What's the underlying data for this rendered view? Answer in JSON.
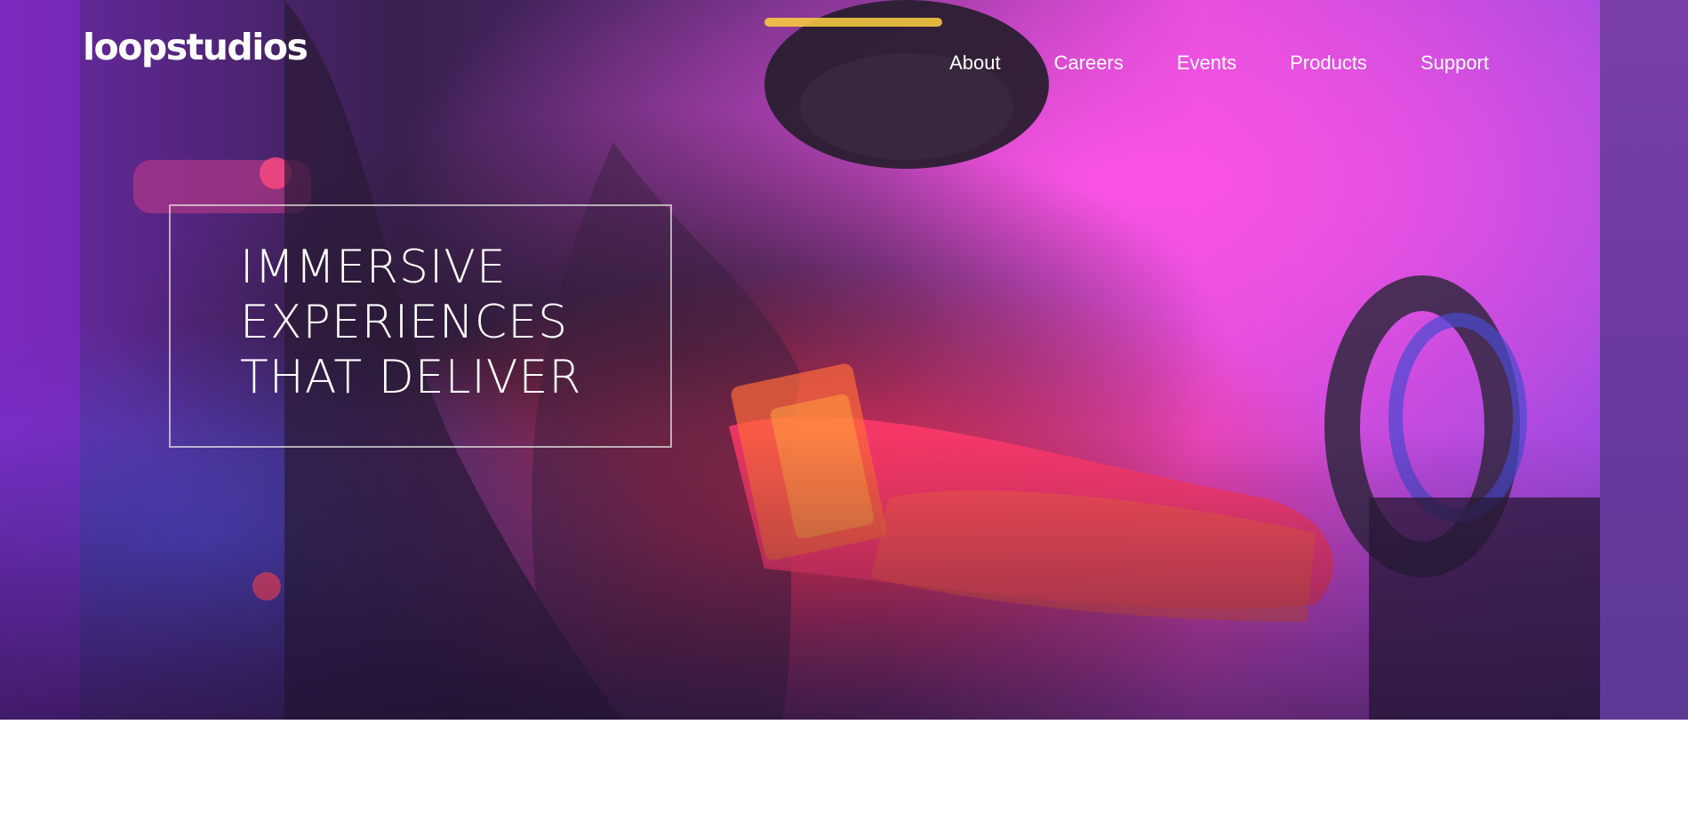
{
  "header": {
    "logo": "loopstudios",
    "nav": [
      {
        "label": "About"
      },
      {
        "label": "Careers"
      },
      {
        "label": "Events"
      },
      {
        "label": "Products"
      },
      {
        "label": "Support"
      }
    ]
  },
  "hero": {
    "headline_lines": [
      "IMMERSIVE",
      "EXPERIENCES",
      "THAT DELIVER"
    ],
    "image_description_icon": "vr-racing-photo"
  },
  "colors": {
    "overlay_magenta": "#ff3bd4",
    "overlay_blue": "#2f3ad8",
    "overlay_red": "#ff2d55",
    "dark": "#2a1a35",
    "side_strip": "#6a3aa0"
  }
}
